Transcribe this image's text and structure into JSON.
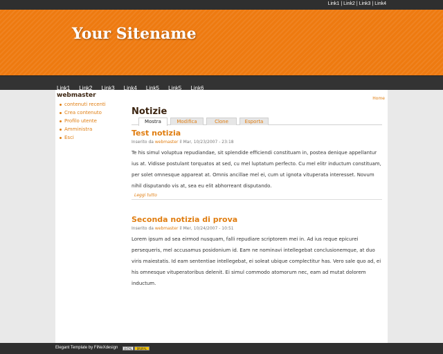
{
  "top_links": [
    "Link1",
    "Link2",
    "Link3",
    "Link4"
  ],
  "site": {
    "name": "Your Sitename"
  },
  "nav": [
    "Link1",
    "Link2",
    "Link3",
    "Link4",
    "Link5",
    "Link5",
    "Link6"
  ],
  "sidebar": {
    "title": "webmaster",
    "items": [
      "contenuti recenti",
      "Crea contenuto",
      "Profilo utente",
      "Amministra",
      "Esci"
    ]
  },
  "breadcrumb": "Home",
  "page_title": "Notizie",
  "tabs": [
    "Mostra",
    "Modifica",
    "Clone",
    "Esporta"
  ],
  "posts": [
    {
      "title": "Test notizia",
      "meta_prefix": "Inserito da ",
      "author": "webmaster",
      "meta_suffix": " il Mar, 10/23/2007 - 23:18",
      "body": "Te his simul voluptua repudiandae, sit splendide efficiendi constituam in, postea denique appellantur ius at. Vidisse postulant torquatos at sed, cu mel luptatum perfecto. Cu mel elitr inductum constituam, per solet omnesque appareat at. Omnis ancillae mel ei, cum ut ignota vituperata interesset. Novum nihil disputando vis at, sea eu elit abhorreant disputando.",
      "read_more": "Leggi tutto"
    },
    {
      "title": "Seconda notizia di prova",
      "meta_prefix": "Inserito da ",
      "author": "webmaster",
      "meta_suffix": " il Mer, 10/24/2007 - 10:51",
      "body": "Lorem ipsum ad sea eirmod nusquam, falli repudiare scriptorem mei in. Ad ius reque epicurei persequeris, mel accusamus posidonium id. Eam ne nominavi intellegebat conclusionemque, at duo viris maiestatis. Id eam sententiae intellegebat, ei soleat ubique complectitur has. Vero sale quo ad, ei his omnesque vituperatoribus delenit. Ei simul commodo atomorum nec, eam ad mutat dolorem inductum."
    }
  ],
  "footer": {
    "credit": "Elegant Template by FiNeXdesign",
    "badge_a": "XHTML",
    "badge_b": "DRUPAL"
  },
  "colors": {
    "accent": "#e07d10",
    "header_orange": "#ee7a10",
    "dark_bar": "#2f2f2f"
  }
}
